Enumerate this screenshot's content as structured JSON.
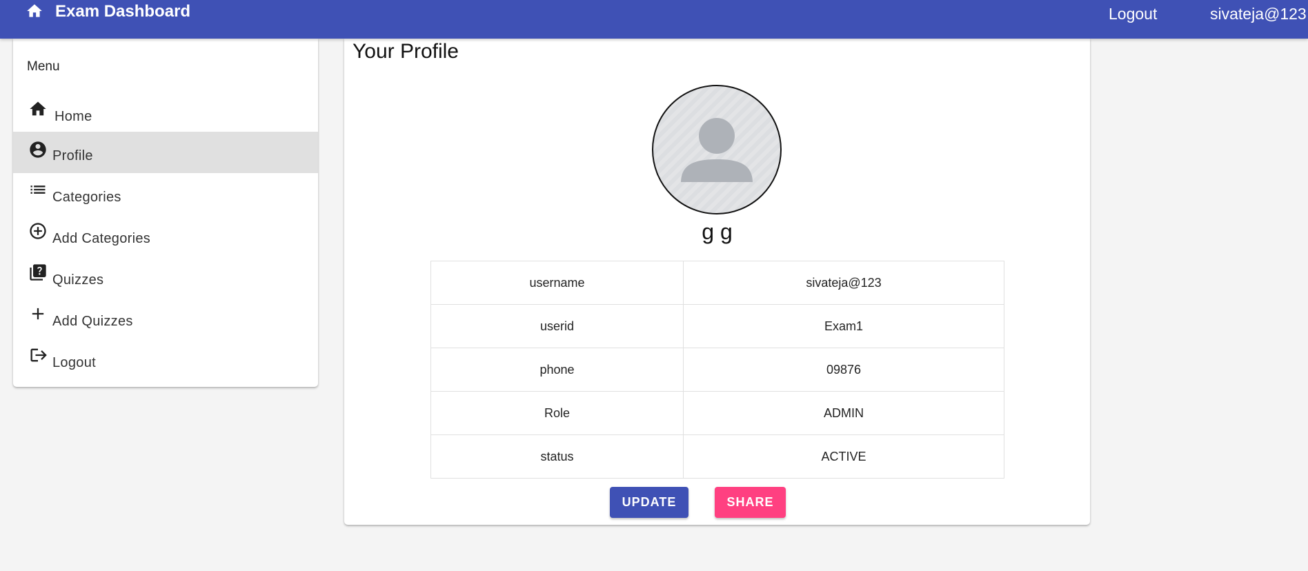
{
  "header": {
    "title": "Exam Dashboard",
    "logout_label": "Logout",
    "username": "sivateja@123",
    "bar_color": "#3f51b5"
  },
  "sidebar": {
    "heading": "Menu",
    "items": [
      {
        "label": "Home",
        "icon": "home-icon"
      },
      {
        "label": "Profile",
        "icon": "account-circle-icon",
        "active": true
      },
      {
        "label": "Categories",
        "icon": "list-icon"
      },
      {
        "label": "Add Categories",
        "icon": "add-circle-outline-icon"
      },
      {
        "label": "Quizzes",
        "icon": "quiz-icon"
      },
      {
        "label": "Add Quizzes",
        "icon": "add-icon"
      },
      {
        "label": "Logout",
        "icon": "logout-icon"
      }
    ]
  },
  "profile": {
    "title": "Your Profile",
    "full_name": "g g",
    "rows": [
      {
        "key": "username",
        "value": "sivateja@123"
      },
      {
        "key": "userid",
        "value": "Exam1"
      },
      {
        "key": "phone",
        "value": "09876"
      },
      {
        "key": "Role",
        "value": "ADMIN"
      },
      {
        "key": "status",
        "value": "ACTIVE"
      }
    ],
    "update_label": "UPDATE",
    "share_label": "SHARE",
    "update_color": "#3f51b5",
    "share_color": "#ff4081"
  }
}
